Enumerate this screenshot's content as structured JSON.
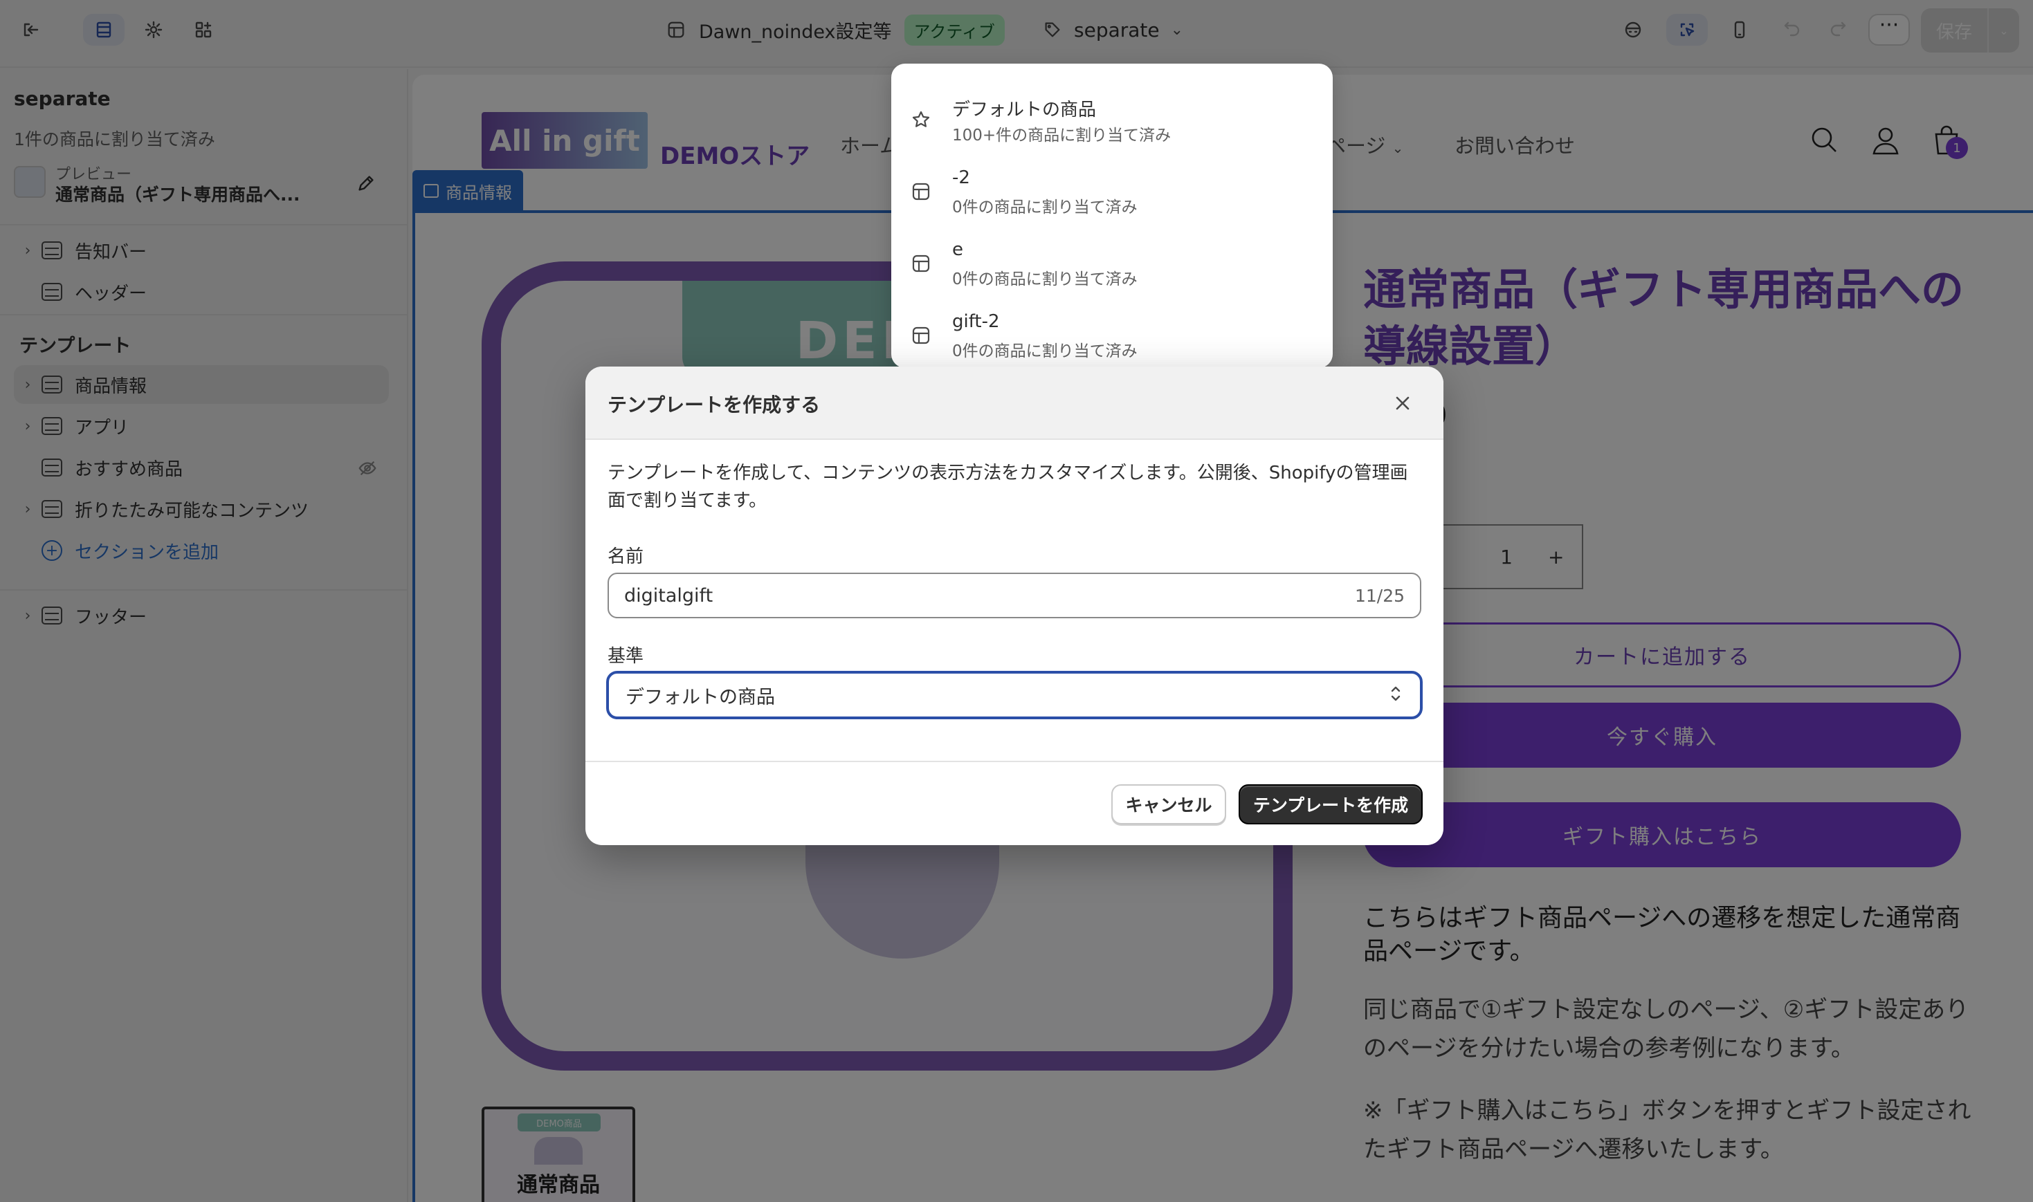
{
  "topbar": {
    "theme_name": "Dawn_noindex設定等",
    "theme_status": "アクティブ",
    "template_selector": "separate",
    "save_label": "保存"
  },
  "sidebar": {
    "template_name": "separate",
    "assigned": "1件の商品に割り当て済み",
    "preview_label": "プレビュー",
    "preview_product": "通常商品（ギフト専用商品へ...",
    "header_items": [
      {
        "label": "告知バー"
      },
      {
        "label": "ヘッダー"
      }
    ],
    "template_heading": "テンプレート",
    "template_items": [
      {
        "label": "商品情報"
      },
      {
        "label": "アプリ"
      },
      {
        "label": "おすすめ商品"
      },
      {
        "label": "折りたたみ可能なコンテンツ"
      }
    ],
    "add_section": "セクションを追加",
    "footer_items": [
      {
        "label": "フッター"
      }
    ]
  },
  "preview": {
    "logo_text": "All in gift",
    "store_name": "DEMOストア",
    "nav": [
      "ホーム",
      "ページ",
      "お問い合わせ"
    ],
    "cart_count": "1",
    "section_tag": "商品情報",
    "image_banner": "DEMO",
    "thumb_badge": "DEMO商品",
    "thumb_title": "通常商品",
    "product_title": "通常商品（ギフト専用商品への導線設置）",
    "price_fragment": "0",
    "quantity": "1",
    "qty_minus": "−",
    "qty_plus": "+",
    "add_to_cart": "カートに追加する",
    "buy_now": "今すぐ購入",
    "gift_buy": "ギフト購入はこちら",
    "desc1": "こちらはギフト商品ページへの遷移を想定した通常商品ページです。",
    "desc2": "同じ商品で①ギフト設定なしのページ、②ギフト設定ありのページを分けたい場合の参考例になります。",
    "desc3": "※「ギフト購入はこちら」ボタンを押すとギフト設定されたギフト商品ページへ遷移いたします。"
  },
  "dropdown": {
    "items": [
      {
        "name": "デフォルトの商品",
        "sub": "100+件の商品に割り当て済み",
        "icon": "star-icon"
      },
      {
        "name": "-2",
        "sub": "0件の商品に割り当て済み",
        "icon": "template-icon"
      },
      {
        "name": "e",
        "sub": "0件の商品に割り当て済み",
        "icon": "template-icon"
      },
      {
        "name": "gift-2",
        "sub": "0件の商品に割り当て済み",
        "icon": "template-icon"
      }
    ]
  },
  "modal": {
    "title": "テンプレートを作成する",
    "description": "テンプレートを作成して、コンテンツの表示方法をカスタマイズします。公開後、Shopifyの管理画面で割り当てます。",
    "name_label": "名前",
    "name_value": "digitalgift",
    "name_count": "11/25",
    "base_label": "基準",
    "base_value": "デフォルトの商品",
    "cancel": "キャンセル",
    "create": "テンプレートを作成"
  },
  "colors": {
    "brand_purple": "#7a3fd8",
    "selection_blue": "#2c6ecb",
    "active_badge": "#b4f1c3"
  }
}
